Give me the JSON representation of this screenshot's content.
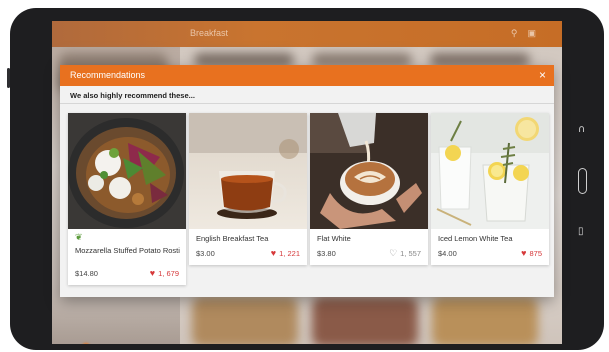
{
  "background_app": {
    "title": "Breakfast",
    "header_icons": [
      "search-icon",
      "cart-icon"
    ]
  },
  "modal": {
    "title": "Recommendations",
    "close_glyph": "×",
    "subtitle": "We also highly recommend these..."
  },
  "cards": [
    {
      "name": "Mozzarella Stuffed Potato Rosti",
      "price": "$14.80",
      "likes": "1, 679",
      "liked": true,
      "vegetarian": true
    },
    {
      "name": "English Breakfast Tea",
      "price": "$3.00",
      "likes": "1, 221",
      "liked": true,
      "vegetarian": false
    },
    {
      "name": "Flat White",
      "price": "$3.80",
      "likes": "1, 557",
      "liked": false,
      "vegetarian": false
    },
    {
      "name": "Iced Lemon White Tea",
      "price": "$4.00",
      "likes": "875",
      "liked": true,
      "vegetarian": false
    }
  ],
  "colors": {
    "accent": "#e8711f",
    "liked_heart": "#d6383a",
    "veg_icon": "#5a9a3a"
  }
}
